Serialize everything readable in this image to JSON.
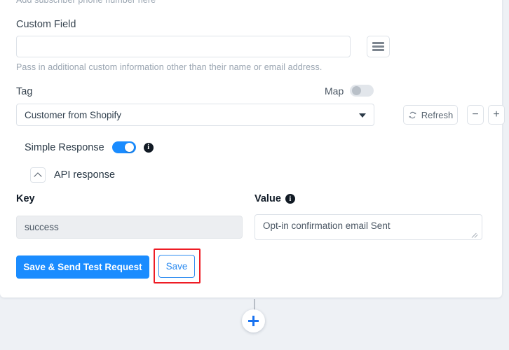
{
  "hints": {
    "phone_hint": "Add subscriber phone number here",
    "custom_field_hint": "Pass in additional custom information other than their name or email address."
  },
  "custom_field": {
    "label": "Custom Field",
    "value": "",
    "placeholder": "",
    "list_icon": "hamburger-icon"
  },
  "tag": {
    "label": "Tag",
    "selected": "Customer from Shopify",
    "map_label": "Map",
    "map_enabled": false,
    "refresh_label": "Refresh",
    "minus_label": "−",
    "plus_label": "+"
  },
  "simple_response": {
    "label": "Simple Response",
    "enabled": true,
    "info_glyph": "i"
  },
  "api_response": {
    "title": "API response",
    "expanded": true,
    "chevron_icon": "chevron-up-icon",
    "key_header": "Key",
    "value_header": "Value",
    "value_info_glyph": "i",
    "rows": [
      {
        "key": "success",
        "value": "Opt-in confirmation email Sent"
      }
    ]
  },
  "actions": {
    "primary_label": "Save & Send Test Request",
    "secondary_label": "Save",
    "highlight_color": "#ee1c25",
    "accent_color": "#1a8cff"
  },
  "flow": {
    "add_node_icon": "plus-icon"
  }
}
